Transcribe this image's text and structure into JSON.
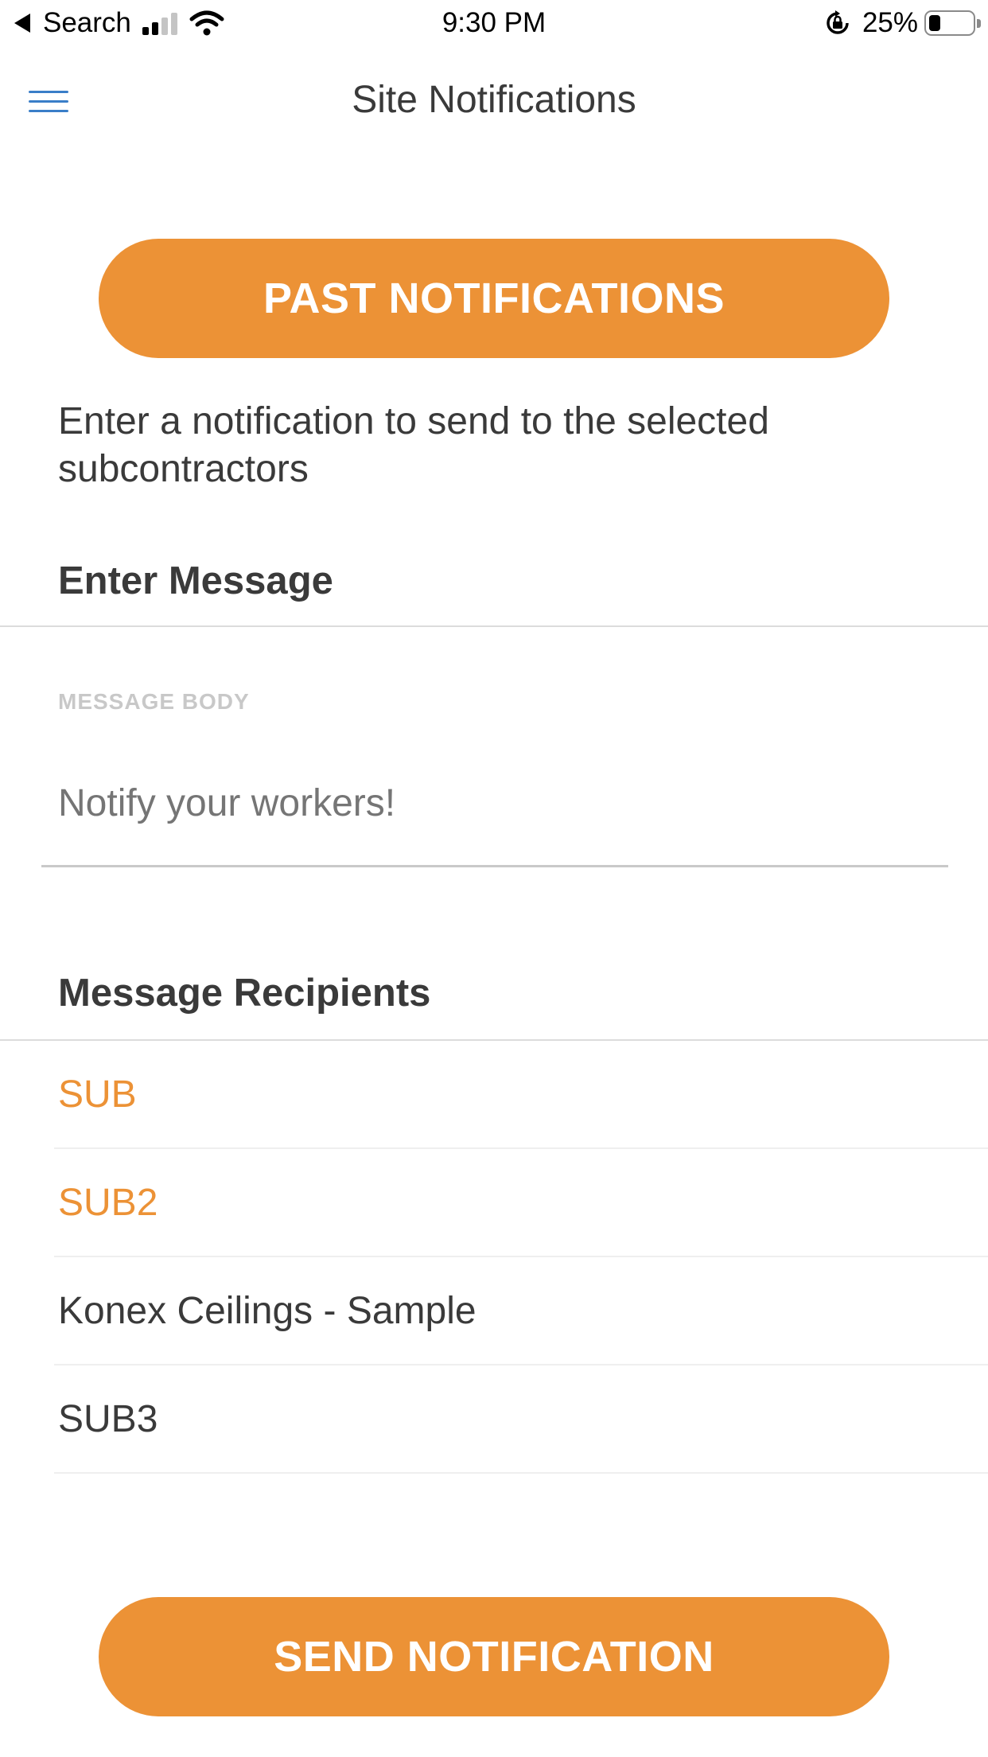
{
  "status_bar": {
    "back_label": "Search",
    "time": "9:30 PM",
    "battery_percent": "25%",
    "battery_level": 0.25,
    "icons": [
      "back-arrow-icon",
      "signal-icon",
      "wifi-icon",
      "rotation-lock-icon",
      "battery-icon"
    ]
  },
  "nav": {
    "title": "Site Notifications",
    "menu_icon": "hamburger-menu-icon"
  },
  "past_button": {
    "label": "PAST NOTIFICATIONS"
  },
  "description": "Enter a notification to send to the selected subcontractors",
  "message_section": {
    "header": "Enter Message",
    "field_label": "MESSAGE BODY",
    "placeholder": "Notify your workers!",
    "value": ""
  },
  "recipients_section": {
    "header": "Message Recipients",
    "items": [
      {
        "label": "SUB",
        "selected": true
      },
      {
        "label": "SUB2",
        "selected": true
      },
      {
        "label": "Konex Ceilings - Sample",
        "selected": false
      },
      {
        "label": "SUB3",
        "selected": false
      }
    ]
  },
  "send_button": {
    "label": "SEND NOTIFICATION"
  },
  "colors": {
    "accent": "#ec9236",
    "menu_icon": "#3a7ec8",
    "text": "#3a3a3a"
  }
}
